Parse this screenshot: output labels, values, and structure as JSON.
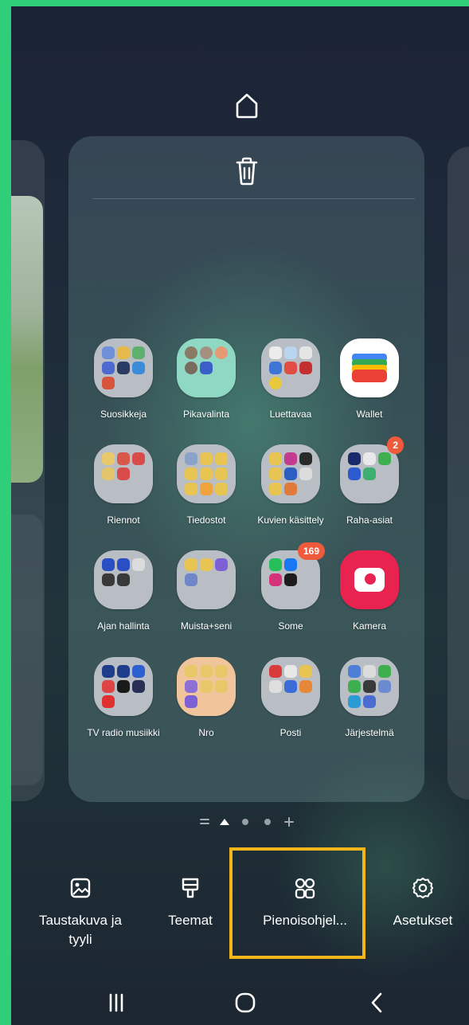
{
  "home_screen_edit": {
    "page_indicator": {
      "pages": 3,
      "current": 1
    },
    "apps": [
      {
        "label": "Suosikkeja",
        "style": "folder"
      },
      {
        "label": "Pikavalinta",
        "style": "folder-teal"
      },
      {
        "label": "Luettavaa",
        "style": "folder"
      },
      {
        "label": "Wallet",
        "style": "wallet"
      },
      {
        "label": "Riennot",
        "style": "folder"
      },
      {
        "label": "Tiedostot",
        "style": "folder"
      },
      {
        "label": "Kuvien käsittely",
        "style": "folder"
      },
      {
        "label": "Raha-asiat",
        "style": "folder",
        "badge": "2"
      },
      {
        "label": "Ajan hallinta",
        "style": "folder"
      },
      {
        "label": "Muista+seni",
        "style": "folder"
      },
      {
        "label": "Some",
        "style": "folder",
        "badge": "169"
      },
      {
        "label": "Kamera",
        "style": "camera"
      },
      {
        "label": "TV radio musiikki",
        "style": "folder"
      },
      {
        "label": "Nro",
        "style": "folder-peach"
      },
      {
        "label": "Posti",
        "style": "folder"
      },
      {
        "label": "Järjestelmä",
        "style": "folder"
      }
    ]
  },
  "dock": {
    "wallpaper_label": "Taustakuva ja tyyli",
    "themes_label": "Teemat",
    "widgets_label": "Pienoisohjel...",
    "settings_label": "Asetukset"
  },
  "colors": {
    "highlight": "#f3b51a",
    "badge": "#ee5a3b",
    "frame": "#2ecf78"
  }
}
